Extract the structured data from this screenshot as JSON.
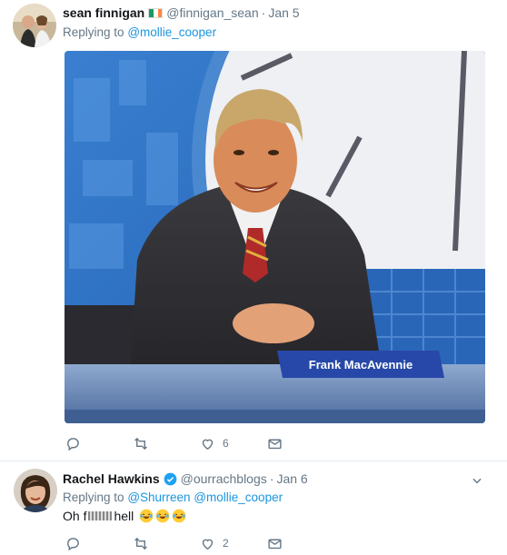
{
  "tweets": [
    {
      "author": {
        "name": "sean finnigan",
        "handle": "@finnigan_sean",
        "flag": "ireland-flag-emoji"
      },
      "time": "Jan 5",
      "replying_prefix": "Replying to",
      "replying_to": "@mollie_cooper",
      "media": {
        "caption_plate": "Frank MacAvennie"
      },
      "actions": {
        "reply_count": "",
        "retweet_count": "",
        "like_count": "6"
      }
    },
    {
      "author": {
        "name": "Rachel Hawkins",
        "handle": "@ourrachblogs",
        "verified": true
      },
      "time": "Jan 6",
      "replying_prefix": "Replying to",
      "replying_to_1": "@Shurreen",
      "replying_to_2": "@mollie_cooper",
      "text_start": "Oh f",
      "text_end": " hell",
      "emojis": [
        "face-with-tears-of-joy",
        "face-with-tears-of-joy",
        "face-with-tears-of-joy"
      ],
      "actions": {
        "reply_count": "",
        "retweet_count": "",
        "like_count": "2"
      }
    }
  ],
  "colors": {
    "link": "#1b95e0",
    "secondary_text": "#657786",
    "divider": "#e6ecf0",
    "verified": "#1da1f2"
  }
}
